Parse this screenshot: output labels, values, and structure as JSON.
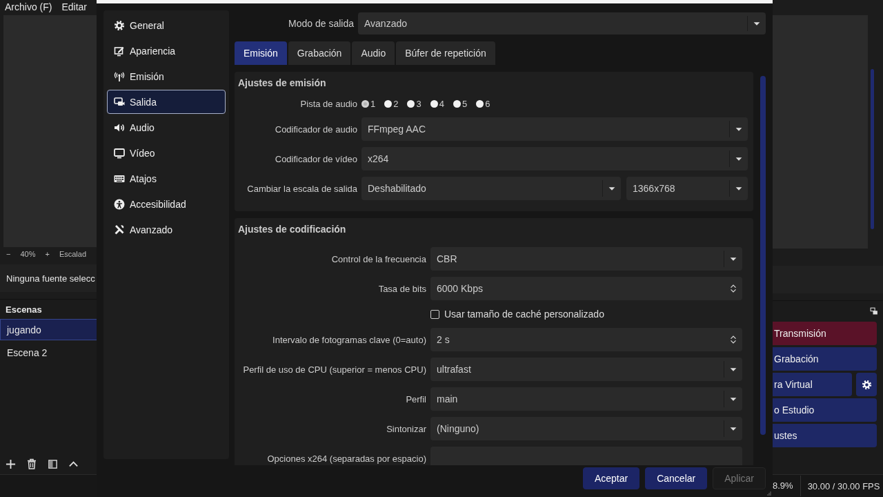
{
  "main_window": {
    "menu": [
      "Archivo (F)",
      "Editar"
    ],
    "zoom_bar": {
      "zoom_out": "−",
      "zoom": "40%",
      "zoom_in": "+",
      "scaling": "Escalad"
    },
    "source_info": "Ninguna fuente selecc",
    "scenes": {
      "title": "Escenas",
      "items": [
        {
          "label": "jugando",
          "selected": true
        },
        {
          "label": "Escena 2",
          "selected": false
        }
      ]
    },
    "controls": [
      {
        "label": "Transmisión",
        "kind": "stream"
      },
      {
        "label": "Grabación",
        "kind": "normal"
      },
      {
        "label": "ra Virtual",
        "kind": "with-settings"
      },
      {
        "label": "o Estudio",
        "kind": "normal"
      },
      {
        "label": "ustes",
        "kind": "normal"
      }
    ],
    "status": {
      "cpu": "8.9%",
      "fps": "30.00 / 30.00 FPS"
    }
  },
  "settings_dialog": {
    "sidebar": [
      {
        "label": "General",
        "kind": "general",
        "selected": false
      },
      {
        "label": "Apariencia",
        "kind": "appearance",
        "selected": false
      },
      {
        "label": "Emisión",
        "kind": "stream",
        "selected": false
      },
      {
        "label": "Salida",
        "kind": "output",
        "selected": true
      },
      {
        "label": "Audio",
        "kind": "audio",
        "selected": false
      },
      {
        "label": "Vídeo",
        "kind": "video",
        "selected": false
      },
      {
        "label": "Atajos",
        "kind": "hotkeys",
        "selected": false
      },
      {
        "label": "Accesibilidad",
        "kind": "accessibility",
        "selected": false
      },
      {
        "label": "Avanzado",
        "kind": "advanced",
        "selected": false
      }
    ],
    "output_mode": {
      "label": "Modo de salida",
      "value": "Avanzado"
    },
    "tabs": [
      {
        "label": "Emisión",
        "selected": true
      },
      {
        "label": "Grabación",
        "selected": false
      },
      {
        "label": "Audio",
        "selected": false
      },
      {
        "label": "Búfer de repetición",
        "selected": false
      }
    ],
    "groups": [
      {
        "title": "Ajustes de emisión",
        "rows": [
          {
            "kind": "radios",
            "label": "Pista de audio",
            "options": [
              {
                "label": "1",
                "selected": true
              },
              {
                "label": "2",
                "selected": false
              },
              {
                "label": "3",
                "selected": false
              },
              {
                "label": "4",
                "selected": false
              },
              {
                "label": "5",
                "selected": false
              },
              {
                "label": "6",
                "selected": false
              }
            ]
          },
          {
            "kind": "select",
            "label": "Codificador de audio",
            "value": "FFmpeg AAC"
          },
          {
            "kind": "select",
            "label": "Codificador de vídeo",
            "value": "x264"
          },
          {
            "kind": "select-pair",
            "label": "Cambiar la escala de salida",
            "value": "Deshabilitado",
            "value_2": "1366x768"
          }
        ]
      },
      {
        "title": "Ajustes de codificación",
        "rows": [
          {
            "kind": "select",
            "label": "Control de la frecuencia",
            "value": "CBR"
          },
          {
            "kind": "spin",
            "label": "Tasa de bits",
            "value": "6000 Kbps"
          },
          {
            "kind": "checkbox",
            "label": "Usar tamaño de caché personalizado",
            "checked": false
          },
          {
            "kind": "spin",
            "label": "Intervalo de fotogramas clave (0=auto)",
            "value": "2 s"
          },
          {
            "kind": "select",
            "label": "Perfil de uso de CPU (superior = menos CPU)",
            "value": "ultrafast"
          },
          {
            "kind": "select",
            "label": "Perfil",
            "value": "main"
          },
          {
            "kind": "select",
            "label": "Sintonizar",
            "value": "(Ninguno)"
          },
          {
            "kind": "text",
            "label": "Opciones x264 (separadas por espacio)"
          }
        ]
      }
    ],
    "buttons": [
      {
        "label": "Aceptar",
        "disabled": false
      },
      {
        "label": "Cancelar",
        "disabled": false
      },
      {
        "label": "Aplicar",
        "disabled": true
      }
    ]
  }
}
